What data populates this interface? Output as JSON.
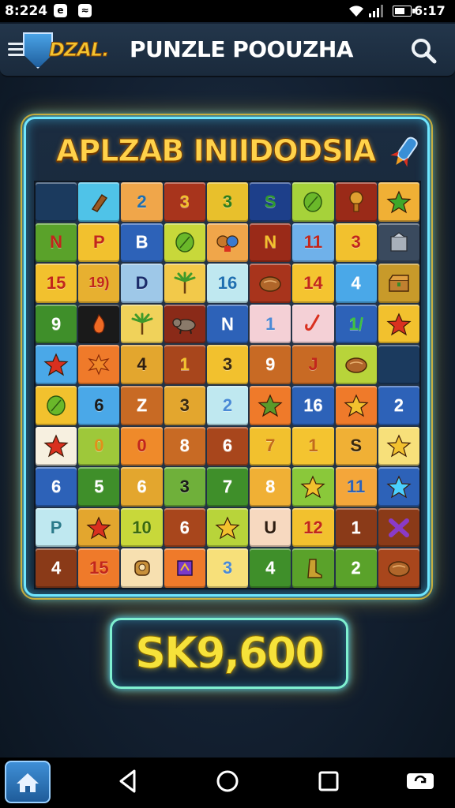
{
  "status_bar": {
    "time": "8:224",
    "battery": "6:17"
  },
  "header": {
    "logo_text": "DZAL.",
    "title": "PUNZLE POOUZHA"
  },
  "board": {
    "title": "APLZAB INIIDODSIA",
    "tiles": [
      [
        {
          "c": "#1b3a5e",
          "t": ""
        },
        {
          "c": "#4fc3e8",
          "i": "club"
        },
        {
          "c": "#f0a64a",
          "t": "2",
          "tc": "#1f6fb0"
        },
        {
          "c": "#a8341c",
          "t": "3",
          "tc": "#f2c12e"
        },
        {
          "c": "#e8c02c",
          "t": "3",
          "tc": "#2e7d1c"
        },
        {
          "c": "#1d3f8a",
          "t": "S",
          "tc": "#2f9a2f"
        },
        {
          "c": "#a6d23a",
          "i": "leaf"
        },
        {
          "c": "#9a2a18",
          "i": "bell"
        },
        {
          "c": "#f0b035",
          "i": "star",
          "ic": "#3fa82a"
        }
      ],
      [
        {
          "c": "#5aa22a",
          "t": "N",
          "tc": "#c2261c"
        },
        {
          "c": "#f2c12e",
          "t": "P",
          "tc": "#c2261c"
        },
        {
          "c": "#2d62b8",
          "t": "B",
          "tc": "#ffffff"
        },
        {
          "c": "#c8d83a",
          "i": "leaf"
        },
        {
          "c": "#f0a64a",
          "i": "mask"
        },
        {
          "c": "#9a2a18",
          "t": "N",
          "tc": "#f2c12e"
        },
        {
          "c": "#6fb1ea",
          "t": "11",
          "tc": "#c2261c"
        },
        {
          "c": "#f2c12e",
          "t": "3",
          "tc": "#c2261c"
        },
        {
          "c": "#3a4a5e",
          "i": "statue"
        }
      ],
      [
        {
          "c": "#f2c12e",
          "t": "15",
          "tc": "#c2261c"
        },
        {
          "c": "#e7b030",
          "t": "19)",
          "tc": "#c2261c"
        },
        {
          "c": "#9ec8e8",
          "t": "D",
          "tc": "#1b2c6a"
        },
        {
          "c": "#f2c94a",
          "i": "palm"
        },
        {
          "c": "#bfe8f0",
          "t": "16",
          "tc": "#1f6fb0"
        },
        {
          "c": "#a8341c",
          "i": "bread"
        },
        {
          "c": "#f4c430",
          "t": "14",
          "tc": "#c2261c"
        },
        {
          "c": "#4aa8e8",
          "t": "4",
          "tc": "#ffffff"
        },
        {
          "c": "#c89a2a",
          "i": "chest"
        }
      ],
      [
        {
          "c": "#3f8f2a",
          "t": "9",
          "tc": "#ffffff"
        },
        {
          "c": "#1a1a1a",
          "i": "flame"
        },
        {
          "c": "#f0d25a",
          "i": "palm"
        },
        {
          "c": "#8a2a18",
          "i": "beast"
        },
        {
          "c": "#2d62b8",
          "t": "N",
          "tc": "#ffffff"
        },
        {
          "c": "#f4d0d6",
          "t": "1",
          "tc": "#4a8ad6"
        },
        {
          "c": "#f4d0d6",
          "i": "hook"
        },
        {
          "c": "#2d62b8",
          "t": "1/",
          "tc": "#3fc23f"
        },
        {
          "c": "#f2c12e",
          "i": "star",
          "ic": "#d9301f"
        }
      ],
      [
        {
          "c": "#4aa8e8",
          "i": "star",
          "ic": "#d9301f"
        },
        {
          "c": "#ef7a2a",
          "i": "splat"
        },
        {
          "c": "#e3a62e",
          "t": "4",
          "tc": "#2e1d10"
        },
        {
          "c": "#a8461c",
          "t": "1",
          "tc": "#f2c12e"
        },
        {
          "c": "#f2c12e",
          "t": "3",
          "tc": "#3a2a10"
        },
        {
          "c": "#c86a24",
          "t": "9",
          "tc": "#ffffff"
        },
        {
          "c": "#c86a24",
          "t": "J",
          "tc": "#c2261c"
        },
        {
          "c": "#b8d43a",
          "i": "bread"
        },
        {
          "c": "#1b3a5e",
          "t": ""
        }
      ],
      [
        {
          "c": "#f2c12e",
          "i": "leaf"
        },
        {
          "c": "#4aa8e8",
          "t": "6",
          "tc": "#1a1a1a"
        },
        {
          "c": "#c86a24",
          "t": "Z",
          "tc": "#ffffff"
        },
        {
          "c": "#e3a62e",
          "t": "3",
          "tc": "#3a2a10"
        },
        {
          "c": "#bfe8f0",
          "t": "2",
          "tc": "#4a8ad6"
        },
        {
          "c": "#ef7a2a",
          "i": "star",
          "ic": "#5a9a2a"
        },
        {
          "c": "#2d62b8",
          "t": "16",
          "tc": "#ffffff"
        },
        {
          "c": "#ef7a2a",
          "i": "star",
          "ic": "#f2c12e"
        },
        {
          "c": "#2d62b8",
          "t": "2",
          "tc": "#ffffff"
        }
      ],
      [
        {
          "c": "#f7f0e0",
          "i": "star",
          "ic": "#d9301f"
        },
        {
          "c": "#9ec83a",
          "t": "0",
          "tc": "#e0901a"
        },
        {
          "c": "#ef8a2a",
          "t": "0",
          "tc": "#c2261c"
        },
        {
          "c": "#c86a24",
          "t": "8",
          "tc": "#ffffff"
        },
        {
          "c": "#a8461c",
          "t": "6",
          "tc": "#ffffff"
        },
        {
          "c": "#f2c12e",
          "t": "7",
          "tc": "#c26a1c"
        },
        {
          "c": "#f4c430",
          "t": "1",
          "tc": "#c26a1c"
        },
        {
          "c": "#f0b035",
          "t": "S",
          "tc": "#3a2a10"
        },
        {
          "c": "#f7e07a",
          "i": "star",
          "ic": "#f2c12e"
        }
      ],
      [
        {
          "c": "#2d62b8",
          "t": "6",
          "tc": "#ffffff"
        },
        {
          "c": "#3f8f2a",
          "t": "5",
          "tc": "#ffffff"
        },
        {
          "c": "#e3a62e",
          "t": "6",
          "tc": "#ffffff"
        },
        {
          "c": "#6fb03a",
          "t": "3",
          "tc": "#1a1a1a"
        },
        {
          "c": "#3f8f2a",
          "t": "7",
          "tc": "#ffffff"
        },
        {
          "c": "#f0b035",
          "t": "8",
          "tc": "#ffffff"
        },
        {
          "c": "#8ac83a",
          "i": "star",
          "ic": "#f2c12e"
        },
        {
          "c": "#f4a63a",
          "t": "11",
          "tc": "#2d62b8"
        },
        {
          "c": "#2d62b8",
          "i": "star",
          "ic": "#4ad0ff"
        }
      ],
      [
        {
          "c": "#bfe8f0",
          "t": "P",
          "tc": "#2a7a8a"
        },
        {
          "c": "#e3a62e",
          "i": "star",
          "ic": "#d9301f"
        },
        {
          "c": "#c8d83a",
          "t": "10",
          "tc": "#3a6a10"
        },
        {
          "c": "#a8461c",
          "t": "6",
          "tc": "#ffffff"
        },
        {
          "c": "#b8d43a",
          "i": "star",
          "ic": "#f2c12e"
        },
        {
          "c": "#f7d9c0",
          "t": "U",
          "tc": "#2e1d10"
        },
        {
          "c": "#f2c12e",
          "t": "12",
          "tc": "#c2261c"
        },
        {
          "c": "#8a3a18",
          "t": "1",
          "tc": "#ffffff"
        },
        {
          "c": "#8a3a18",
          "i": "splat2"
        }
      ],
      [
        {
          "c": "#8a3a18",
          "t": "4",
          "tc": "#ffffff"
        },
        {
          "c": "#ef7a2a",
          "t": "15",
          "tc": "#c2261c"
        },
        {
          "c": "#f7e0b0",
          "i": "robot"
        },
        {
          "c": "#ef7a2a",
          "i": "chip"
        },
        {
          "c": "#f7e07a",
          "t": "3",
          "tc": "#4a8ad6"
        },
        {
          "c": "#3f8f2a",
          "t": "4",
          "tc": "#ffffff"
        },
        {
          "c": "#5aa22a",
          "i": "boot"
        },
        {
          "c": "#5aa22a",
          "t": "2",
          "tc": "#ffffff"
        },
        {
          "c": "#a8461c",
          "i": "bread"
        }
      ]
    ]
  },
  "score": {
    "value": "SK9,600"
  },
  "icons": [
    "menu-icon",
    "shield-logo-icon",
    "search-icon",
    "rocket-icon",
    "home-icon",
    "back-icon",
    "home-circle-icon",
    "recents-icon",
    "screenshot-icon"
  ],
  "colors": {
    "accent_cyan": "#6fe6ff",
    "accent_gold": "#f4c430",
    "score_yellow": "#f6e23a"
  }
}
